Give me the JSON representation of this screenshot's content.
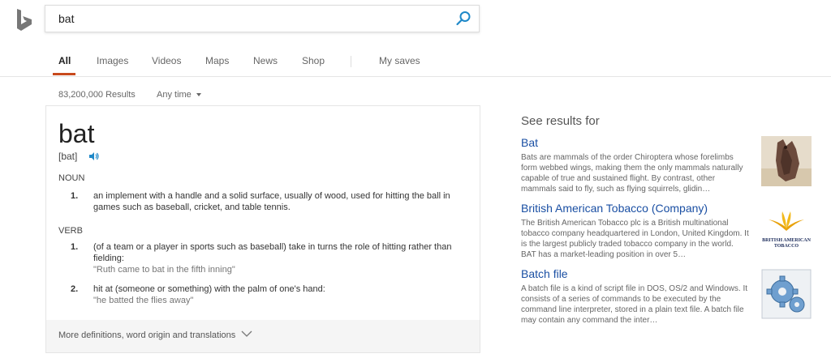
{
  "search": {
    "query": "bat"
  },
  "nav": {
    "tabs": [
      {
        "label": "All",
        "active": true
      },
      {
        "label": "Images"
      },
      {
        "label": "Videos"
      },
      {
        "label": "Maps"
      },
      {
        "label": "News"
      },
      {
        "label": "Shop"
      },
      {
        "label": "My saves"
      }
    ]
  },
  "results": {
    "count": "83,200,000 Results",
    "time_filter": "Any time"
  },
  "dictionary": {
    "word": "bat",
    "pronunciation": "[bat]",
    "noun": {
      "label": "NOUN",
      "definitions": [
        {
          "num": "1.",
          "text": "an implement with a handle and a solid surface, usually of wood, used for hitting the ball in games such as baseball, cricket, and table tennis."
        }
      ]
    },
    "verb": {
      "label": "VERB",
      "definitions": [
        {
          "num": "1.",
          "text": "(of a team or a player in sports such as baseball) take in turns the role of hitting rather than fielding:",
          "example": "\"Ruth came to bat in the fifth inning\""
        },
        {
          "num": "2.",
          "text": "hit at (someone or something) with the palm of one's hand:",
          "example": "\"he batted the flies away\""
        }
      ]
    },
    "more": "More definitions, word origin and translations"
  },
  "sidebar": {
    "heading": "See results for",
    "entities": [
      {
        "title": "Bat",
        "snippet": "Bats are mammals of the order Chiroptera whose forelimbs form webbed wings, making them the only mammals naturally capable of true and sustained flight. By contrast, other mammals said to fly, such as flying squirrels, glidin…"
      },
      {
        "title": "British American Tobacco (Company)",
        "snippet": "The British American Tobacco plc is a British multinational tobacco company headquartered in London, United Kingdom. It is the largest publicly traded tobacco company in the world. BAT has a market-leading position in over 5…",
        "logo_text": "BRITISH AMERICAN TOBACCO"
      },
      {
        "title": "Batch file",
        "snippet": "A batch file is a kind of script file in DOS, OS/2 and Windows. It consists of a series of commands to be executed by the command line interpreter, stored in a plain text file. A batch file may contain any command the inter…"
      }
    ]
  },
  "colors": {
    "accent": "#c84a1c",
    "link": "#1a4fa3",
    "speaker": "#1e88c8"
  }
}
